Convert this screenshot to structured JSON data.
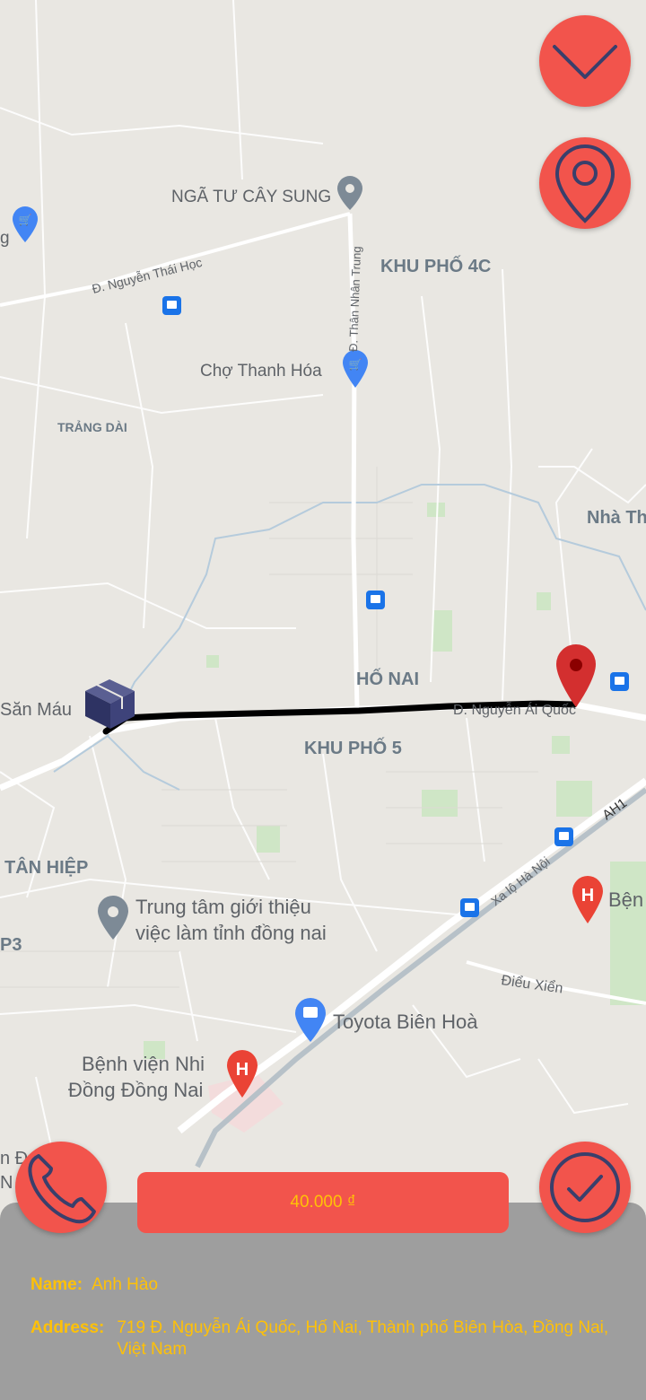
{
  "map": {
    "places": {
      "nga_tu_cay_sung": "NGÃ TƯ CÂY SUNG",
      "khu_pho_4c": "KHU PHỐ 4C",
      "nguyen_thai_hoc": "Đ. Nguyễn Thái Học",
      "than_nhan_trung": "Đ. Thân Nhân Trung",
      "cho_thanh_hoa": "Chợ Thanh Hóa",
      "trang_dai": "TRẢNG DÀI",
      "nha_th": "Nhà Th",
      "ho_nai": "HỐ NAI",
      "san_mau": "Săn Máu",
      "nguyen_ai_quoc": "Đ. Nguyễn Ái Quốc",
      "khu_pho_5": "KHU PHỐ 5",
      "ah1": "AH1",
      "tan_hiep": "TÂN HIỆP",
      "trung_tam_line1": "Trung tâm giới thiệu",
      "trung_tam_line2": "việc làm tỉnh đồng nai",
      "xa_lo_ha_noi": "Xa lộ Hà Nội",
      "ben": "Bện",
      "p3": "P3",
      "dieu_xien": "Điểu Xiển",
      "toyota": "Toyota Biên Hoà",
      "benh_vien_line1": "Bệnh viện Nhi",
      "benh_vien_line2": "Đồng Đồng Nai",
      "partial_g": "g",
      "partial_da": "n Đa",
      "partial_n": "N"
    },
    "colors": {
      "background": "#e9e7e2",
      "route": "#000000",
      "marker": "#d32f2f"
    }
  },
  "buttons": {
    "collapse_icon": "chevron-down-icon",
    "location_icon": "location-pin-icon",
    "call_icon": "phone-icon",
    "confirm_icon": "check-icon",
    "price_label": "40.000 ₫"
  },
  "order": {
    "name_label": "Name:",
    "name_value": "Anh Hào",
    "address_label": "Address:",
    "address_value": "719 Đ. Nguyễn Ái Quốc, Hố Nai, Thành phố Biên Hòa, Đồng Nai, Việt Nam"
  },
  "theme": {
    "accent": "#f2544c",
    "text_highlight": "#ffc107",
    "panel": "#9e9e9e",
    "icon_stroke": "#3a3f6b"
  }
}
